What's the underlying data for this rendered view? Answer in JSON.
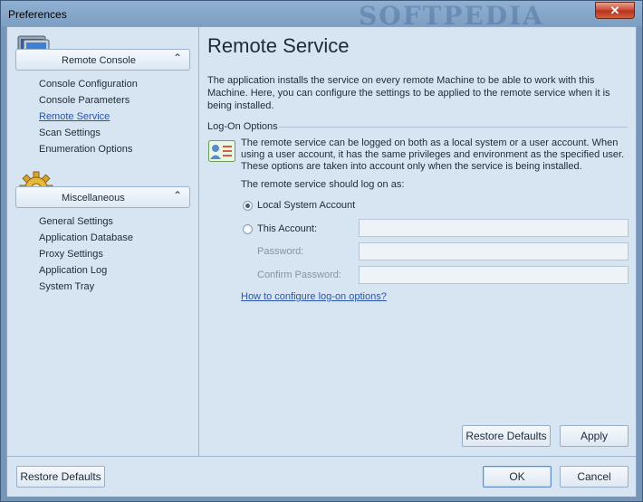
{
  "window": {
    "title": "Preferences",
    "watermark": "SOFTPEDIA",
    "close_glyph": "✕"
  },
  "sidebar": {
    "groups": [
      {
        "label": "Remote Console",
        "icon": "monitor-icon",
        "items": [
          {
            "label": "Console Configuration"
          },
          {
            "label": "Console Parameters"
          },
          {
            "label": "Remote Service",
            "active": true
          },
          {
            "label": "Scan Settings"
          },
          {
            "label": "Enumeration Options"
          }
        ]
      },
      {
        "label": "Miscellaneous",
        "icon": "gear-icon",
        "items": [
          {
            "label": "General Settings"
          },
          {
            "label": "Application Database"
          },
          {
            "label": "Proxy Settings"
          },
          {
            "label": "Application Log"
          },
          {
            "label": "System Tray"
          }
        ]
      }
    ],
    "chevron": "⌃"
  },
  "main": {
    "title": "Remote Service",
    "intro": "The application installs the service on every remote Machine to be able to work with this Machine. Here, you can configure the settings to be applied to the remote service when it is being installed.",
    "section_label": "Log-On Options",
    "info": "The remote service can be logged on both as a local system or a user account. When using a user account, it has the same privileges and environment as the specified user. These options are taken into account only when the service is being installed.",
    "prompt": "The remote service should log on as:",
    "options": {
      "local_system": {
        "label": "Local System Account",
        "checked": true
      },
      "this_account": {
        "label": "This Account:",
        "checked": false,
        "value": ""
      }
    },
    "password": {
      "label": "Password:",
      "value": ""
    },
    "confirm_password": {
      "label": "Confirm Password:",
      "value": ""
    },
    "help_link": "How to configure log-on options?",
    "restore_defaults": "Restore Defaults",
    "apply": "Apply"
  },
  "footer": {
    "restore_defaults": "Restore Defaults",
    "ok": "OK",
    "cancel": "Cancel"
  },
  "colors": {
    "accent": "#2a56a8",
    "link": "#2a56a8",
    "panel": "#d7e4f2",
    "titlebar": "#8fb0d2"
  }
}
